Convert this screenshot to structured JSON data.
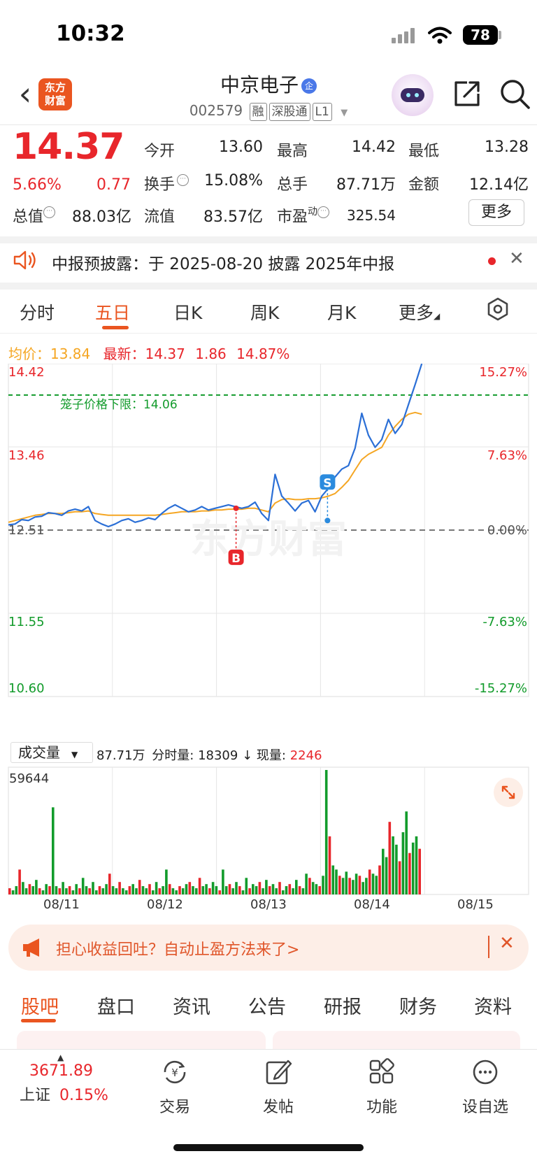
{
  "status_bar": {
    "time": "10:32",
    "battery": "78"
  },
  "header": {
    "logo_line1": "东方",
    "logo_line2": "财富",
    "stock_name": "中京电子",
    "qi_badge": "企",
    "stock_code": "002579",
    "tags": [
      "融",
      "深股通",
      "L1"
    ]
  },
  "quote": {
    "price": "14.37",
    "change_pct": "5.66%",
    "change_amt": "0.77",
    "stats": [
      {
        "label": "今开",
        "value": "13.60",
        "color": "#222222"
      },
      {
        "label": "最高",
        "value": "14.42",
        "color": "#e8262b"
      },
      {
        "label": "最低",
        "value": "13.28",
        "color": "#129b2b"
      },
      {
        "label": "换手",
        "value": "15.08%",
        "color": "#222222"
      },
      {
        "label": "总手",
        "value": "87.71万",
        "color": "#222222"
      },
      {
        "label": "金额",
        "value": "12.14亿",
        "color": "#222222"
      },
      {
        "label": "总值",
        "value": "88.03亿",
        "color": "#222222"
      },
      {
        "label": "流值",
        "value": "83.57亿",
        "color": "#222222"
      },
      {
        "label": "市盈",
        "value": "325.54",
        "color": "#222222"
      }
    ],
    "pe_superscript": "动",
    "more_label": "更多"
  },
  "notice": {
    "text": "中报预披露：于 2025-08-20 披露 2025年中报"
  },
  "period_tabs": [
    "分时",
    "五日",
    "日K",
    "周K",
    "月K",
    "更多"
  ],
  "period_active_index": 1,
  "chart_header": {
    "avg_label": "均价：",
    "avg_value": "13.84",
    "latest_label": "最新：",
    "latest_value": "14.37",
    "latest_change": "1.86",
    "latest_pct": "14.87%"
  },
  "chart_data": {
    "type": "line",
    "y_left_ticks": [
      "14.42",
      "13.46",
      "12.51",
      "11.55",
      "10.60"
    ],
    "y_right_ticks": [
      "15.27%",
      "7.63%",
      "0.00%",
      "-7.63%",
      "-15.27%"
    ],
    "ylim": [
      10.6,
      14.42
    ],
    "prev_close": 12.51,
    "limit_price_label": "笼子价格下限：14.06",
    "limit_price": 14.06,
    "x_labels": [
      "08/11",
      "08/12",
      "08/13",
      "08/14",
      "08/15"
    ],
    "series": [
      {
        "name": "最新",
        "color": "#2b6fd6",
        "values": [
          12.57,
          12.58,
          12.63,
          12.62,
          12.66,
          12.67,
          12.71,
          12.7,
          12.68,
          12.73,
          12.75,
          12.73,
          12.78,
          12.62,
          12.58,
          12.55,
          12.58,
          12.62,
          12.64,
          12.6,
          12.62,
          12.65,
          12.63,
          12.7,
          12.76,
          12.8,
          12.76,
          12.72,
          12.74,
          12.78,
          12.74,
          12.76,
          12.78,
          12.8,
          12.78,
          12.76,
          12.78,
          12.83,
          12.7,
          12.62,
          13.15,
          12.9,
          12.82,
          12.73,
          12.82,
          12.85,
          12.72,
          12.9,
          12.99,
          13.12,
          13.21,
          13.25,
          13.45,
          13.85,
          13.6,
          13.46,
          13.55,
          13.78,
          13.62,
          13.72,
          13.95,
          14.18,
          14.42
        ]
      },
      {
        "name": "均价",
        "color": "#f5a623",
        "values": [
          12.6,
          12.62,
          12.64,
          12.66,
          12.68,
          12.69,
          12.7,
          12.7,
          12.7,
          12.71,
          12.72,
          12.72,
          12.73,
          12.7,
          12.69,
          12.68,
          12.68,
          12.68,
          12.68,
          12.68,
          12.68,
          12.68,
          12.68,
          12.69,
          12.7,
          12.71,
          12.72,
          12.72,
          12.72,
          12.73,
          12.73,
          12.74,
          12.74,
          12.75,
          12.75,
          12.75,
          12.76,
          12.76,
          12.74,
          12.72,
          12.82,
          12.86,
          12.87,
          12.86,
          12.86,
          12.87,
          12.87,
          12.88,
          12.9,
          12.93,
          13.0,
          13.08,
          13.2,
          13.32,
          13.38,
          13.42,
          13.46,
          13.6,
          13.7,
          13.78,
          13.84,
          13.86,
          13.84
        ]
      }
    ],
    "markers": [
      {
        "label": "B",
        "day": 2,
        "price": 12.76
      },
      {
        "label": "S",
        "day": 3,
        "price": 12.62
      }
    ]
  },
  "volume": {
    "selector_label": "成交量",
    "total": "87.71万",
    "tick_label": "分时量:",
    "tick_value": "18309",
    "arrow": "↓",
    "current_label": "现量:",
    "current_value": "2246",
    "max_label": "59644",
    "bars": [
      3,
      2,
      4,
      12,
      6,
      3,
      5,
      4,
      7,
      3,
      2,
      5,
      4,
      42,
      4,
      3,
      6,
      3,
      4,
      2,
      5,
      3,
      8,
      4,
      3,
      6,
      2,
      4,
      3,
      5,
      10,
      4,
      3,
      6,
      3,
      2,
      4,
      5,
      3,
      7,
      4,
      3,
      5,
      2,
      6,
      3,
      4,
      12,
      5,
      3,
      2,
      4,
      3,
      5,
      6,
      4,
      3,
      8,
      4,
      5,
      3,
      6,
      4,
      2,
      12,
      4,
      5,
      3,
      6,
      4,
      2,
      8,
      3,
      5,
      4,
      6,
      3,
      7,
      4,
      5,
      3,
      6,
      2,
      4,
      5,
      3,
      7,
      4,
      3,
      10,
      8,
      6,
      5,
      4,
      9,
      60,
      28,
      14,
      12,
      9,
      8,
      11,
      8,
      7,
      10,
      9,
      6,
      8,
      12,
      10,
      9,
      14,
      22,
      18,
      35,
      28,
      24,
      16,
      30,
      40,
      20,
      25,
      28,
      22
    ]
  },
  "promo": {
    "text": "担心收益回吐？自动止盈方法来了>"
  },
  "content_tabs": [
    "股吧",
    "盘口",
    "资讯",
    "公告",
    "研报",
    "财务",
    "资料"
  ],
  "content_active_index": 0,
  "bottom_nav": {
    "index_value": "3671.89",
    "index_name": "上证",
    "index_pct": "0.15%",
    "items": [
      "交易",
      "发帖",
      "功能",
      "设自选"
    ]
  }
}
